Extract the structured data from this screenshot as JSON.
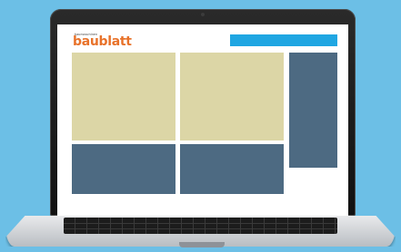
{
  "site": {
    "logo_small": "baumaschinen",
    "logo_main": "baublatt"
  },
  "colors": {
    "background": "#6cbfe6",
    "accent": "#1fa6e2",
    "brand": "#e8722a",
    "tile_light": "#dcd6a6",
    "tile_dark": "#4d6a82"
  }
}
